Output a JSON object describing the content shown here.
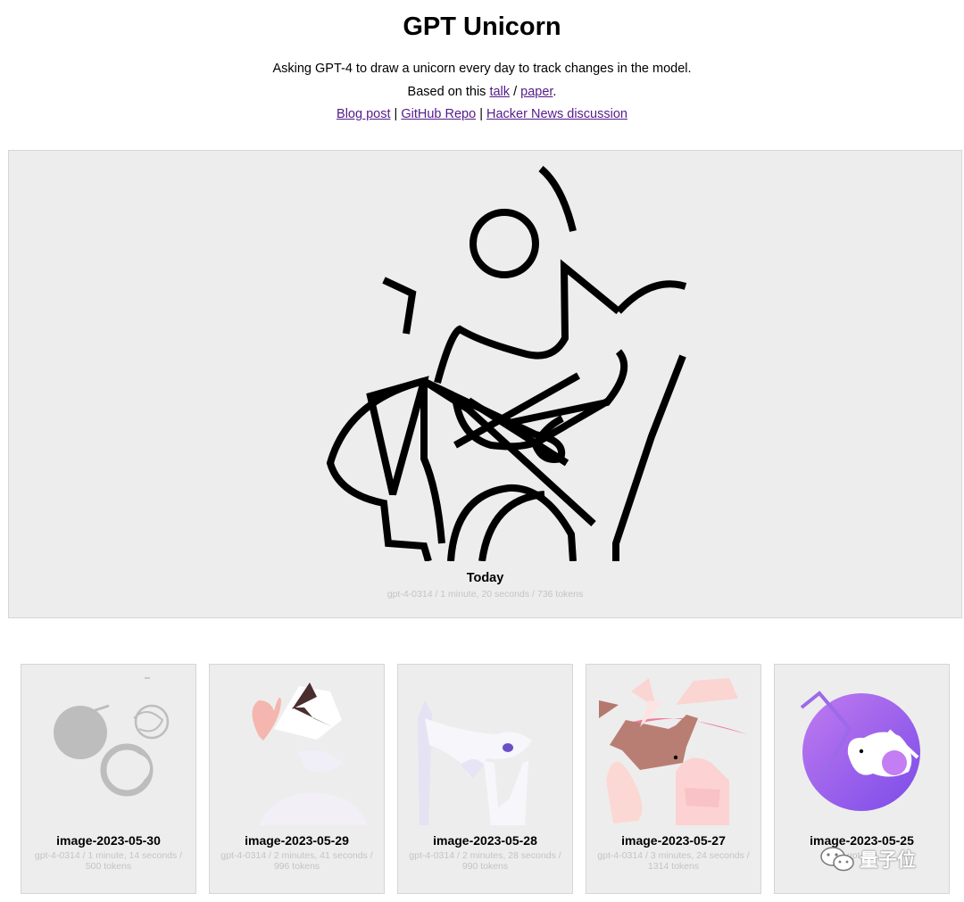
{
  "header": {
    "title": "GPT Unicorn",
    "description": "Asking GPT-4 to draw a unicorn every day to track changes in the model.",
    "based_prefix": "Based on this",
    "talk_link": "talk",
    "slash": "/",
    "paper_link": "paper",
    "period": ".",
    "links": {
      "blog": "Blog post",
      "github": "GitHub Repo",
      "hn": "Hacker News discussion",
      "separator": "|"
    }
  },
  "hero": {
    "title": "Today",
    "meta": "gpt-4-0314 / 1 minute, 20 seconds / 736 tokens"
  },
  "cards": [
    {
      "title": "image-2023-05-30",
      "meta": "gpt-4-0314 / 1 minute, 14 seconds / 500 tokens"
    },
    {
      "title": "image-2023-05-29",
      "meta": "gpt-4-0314 / 2 minutes, 41 seconds / 996 tokens"
    },
    {
      "title": "image-2023-05-28",
      "meta": "gpt-4-0314 / 2 minutes, 28 seconds / 990 tokens"
    },
    {
      "title": "image-2023-05-27",
      "meta": "gpt-4-0314 / 3 minutes, 24 seconds / 1314 tokens"
    },
    {
      "title": "image-2023-05-25",
      "meta": "gpt-4-0"
    }
  ],
  "watermark": {
    "text": "量子位",
    "icon": "wechat-icon"
  }
}
